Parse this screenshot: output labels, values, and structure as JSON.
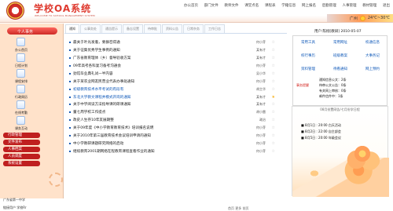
{
  "brand": {
    "title": "学校OA系统",
    "subtitle": "WELCOME TO SCHOOL MANAGEMENT SYSTEM"
  },
  "top_nav": [
    "办公首页",
    "部门文件",
    "教师文件",
    "课堂点名",
    "课程表",
    "学籍信息",
    "网上报名",
    "后勤管理",
    "人事管理",
    "教材管理",
    "退出"
  ],
  "weather": {
    "city": "广州",
    "temp": "24℃~30℃"
  },
  "left": {
    "caption": "个人事务",
    "items": [
      "办公首页",
      "日程计划",
      "课程安排",
      "行政周历",
      "在线考勤",
      "课务互动"
    ],
    "buttons": [
      "行政管理",
      "文件发布",
      "人事档案",
      "人员调度",
      "系统设置"
    ],
    "school": "广东省第一中学",
    "login": "链接用户 学校Rr"
  },
  "tabs": [
    "通知",
    "公事务处",
    "通告提示",
    "备忘设置",
    "待审批",
    "资料公告",
    "日常杂务",
    "工作日志"
  ],
  "notices": [
    {
      "text": "最关于叶光发着，要群召得通",
      "author": "何小芽",
      "star": "☆"
    },
    {
      "text": "关于征集优秀学生事例的通知",
      "author": "某有才",
      "star": "☆"
    },
    {
      "text": "广东省教育理体（乡）督导验收方案",
      "author": "某有才",
      "star": "☆"
    },
    {
      "text": "09年高考各科复习备考沟通会",
      "author": "何小芽",
      "star": "☆"
    },
    {
      "text": "劲馆毕业典礼试一半内容",
      "author": "吴小华",
      "star": "☆"
    },
    {
      "text": "关于某农业网友民营业代表办事处通知",
      "author": "何小芽",
      "star": "☆"
    },
    {
      "text": "初级教育技术水平考试的有段有",
      "author": "胡主华",
      "star": "☆"
    },
    {
      "text": "东北大学教文课程并模式开岗的通知",
      "author": "某有才",
      "star": "★"
    },
    {
      "text": "关于中学阅读方法指导课的研课通知",
      "author": "某有才",
      "star": "☆"
    },
    {
      "text": "董七周学校工作提点",
      "author": "胡小雷",
      "star": "☆"
    },
    {
      "text": "政史人生存10年友展期整",
      "author": "政治",
      "star": "☆"
    },
    {
      "text": "关于09年度《中小学教育教育技术》培训报名说明",
      "author": "何小芽",
      "star": "☆"
    },
    {
      "text": "关于2010年第三届教育技术会议培训申请的通知",
      "author": "何小芽",
      "star": "☆"
    },
    {
      "text": "中小学教研课题研究网络的启动",
      "author": "何小芽",
      "star": "☆"
    },
    {
      "text": "继续教育2001期网络在程教育课程查看作业的通知",
      "author": "何小芽",
      "star": "☆"
    }
  ],
  "footer": {
    "prev": "首页",
    "more": "更多",
    "next": "前页"
  },
  "right": {
    "user": "用户:陈栩[教研] 2010-05-07",
    "links": [
      "常用工具",
      "常用网址",
      "校通信息",
      "校行事历",
      "班级教案",
      "大事务记",
      "资料管理",
      "待看通知",
      "网上预约"
    ],
    "remind_label": "事务提醒",
    "remind": [
      "通知信息公文：2条",
      "待审公文公告：0条",
      "有关网上审核：0条",
      "邮件信件中：1条"
    ],
    "calendar_title": "08月份置网告/七月份学日程",
    "events": [
      "■ 8月1日 : 20:00 白天活动",
      "■ 8月2日 : 22:00 自主部会",
      "■ 8月5日 : 20:00 年级会议"
    ]
  },
  "colors": {
    "brand_red": "#df3a2f",
    "link_blue": "#0d57b8",
    "left_bg": "#ffe2ca",
    "button_red": "#bf1f1f",
    "accent_orange": "#ff9b57"
  }
}
